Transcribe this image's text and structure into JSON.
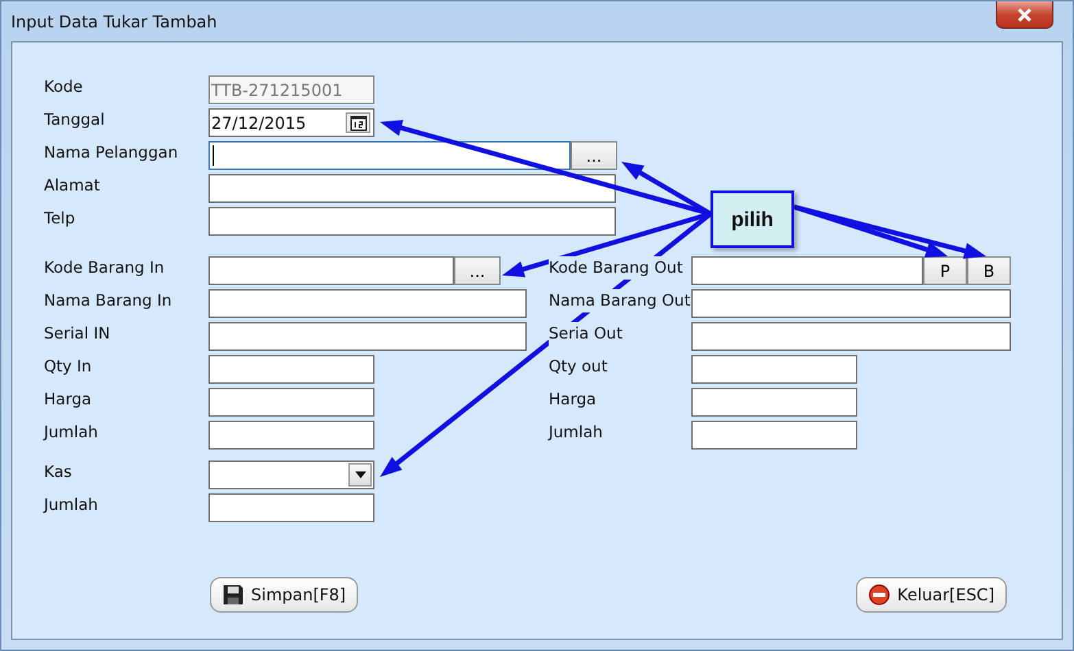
{
  "window": {
    "title": "Input Data Tukar Tambah"
  },
  "customer": [
    {
      "label": "Kode",
      "kind": "text",
      "value": "TTB-271215001",
      "disabled": true,
      "focused": false
    },
    {
      "label": "Tanggal",
      "kind": "date",
      "value": "27/12/2015",
      "disabled": false,
      "focused": false
    },
    {
      "label": "Nama Pelanggan",
      "kind": "lookup",
      "buttons": [
        "..."
      ],
      "disabled": false,
      "focused": true
    },
    {
      "label": "Alamat",
      "kind": "text",
      "disabled": false,
      "focused": false
    },
    {
      "label": "Telp",
      "kind": "text",
      "disabled": false,
      "focused": false
    }
  ],
  "item_in": [
    {
      "label": "Kode Barang In",
      "kind": "lookup",
      "buttons": [
        "..."
      ]
    },
    {
      "label": "Nama Barang In",
      "kind": "text"
    },
    {
      "label": "Serial IN",
      "kind": "text"
    },
    {
      "label": "Qty In",
      "kind": "text"
    },
    {
      "label": "Harga",
      "kind": "text"
    },
    {
      "label": "Jumlah",
      "kind": "text"
    }
  ],
  "item_out": [
    {
      "label": "Kode Barang Out",
      "kind": "lookup",
      "buttons": [
        "P",
        "B"
      ]
    },
    {
      "label": "Nama Barang Out",
      "kind": "text"
    },
    {
      "label": "Seria Out",
      "kind": "text"
    },
    {
      "label": "Qty out",
      "kind": "text"
    },
    {
      "label": "Harga",
      "kind": "text"
    },
    {
      "label": "Jumlah",
      "kind": "text"
    }
  ],
  "payment": [
    {
      "label": "Kas",
      "kind": "combo"
    },
    {
      "label": "Jumlah",
      "kind": "text"
    }
  ],
  "buttons": [
    {
      "label": "Simpan[F8]",
      "kind": "save"
    },
    {
      "label": "Keluar[ESC]",
      "kind": "exit"
    }
  ],
  "annotation": {
    "text": "pilih"
  }
}
